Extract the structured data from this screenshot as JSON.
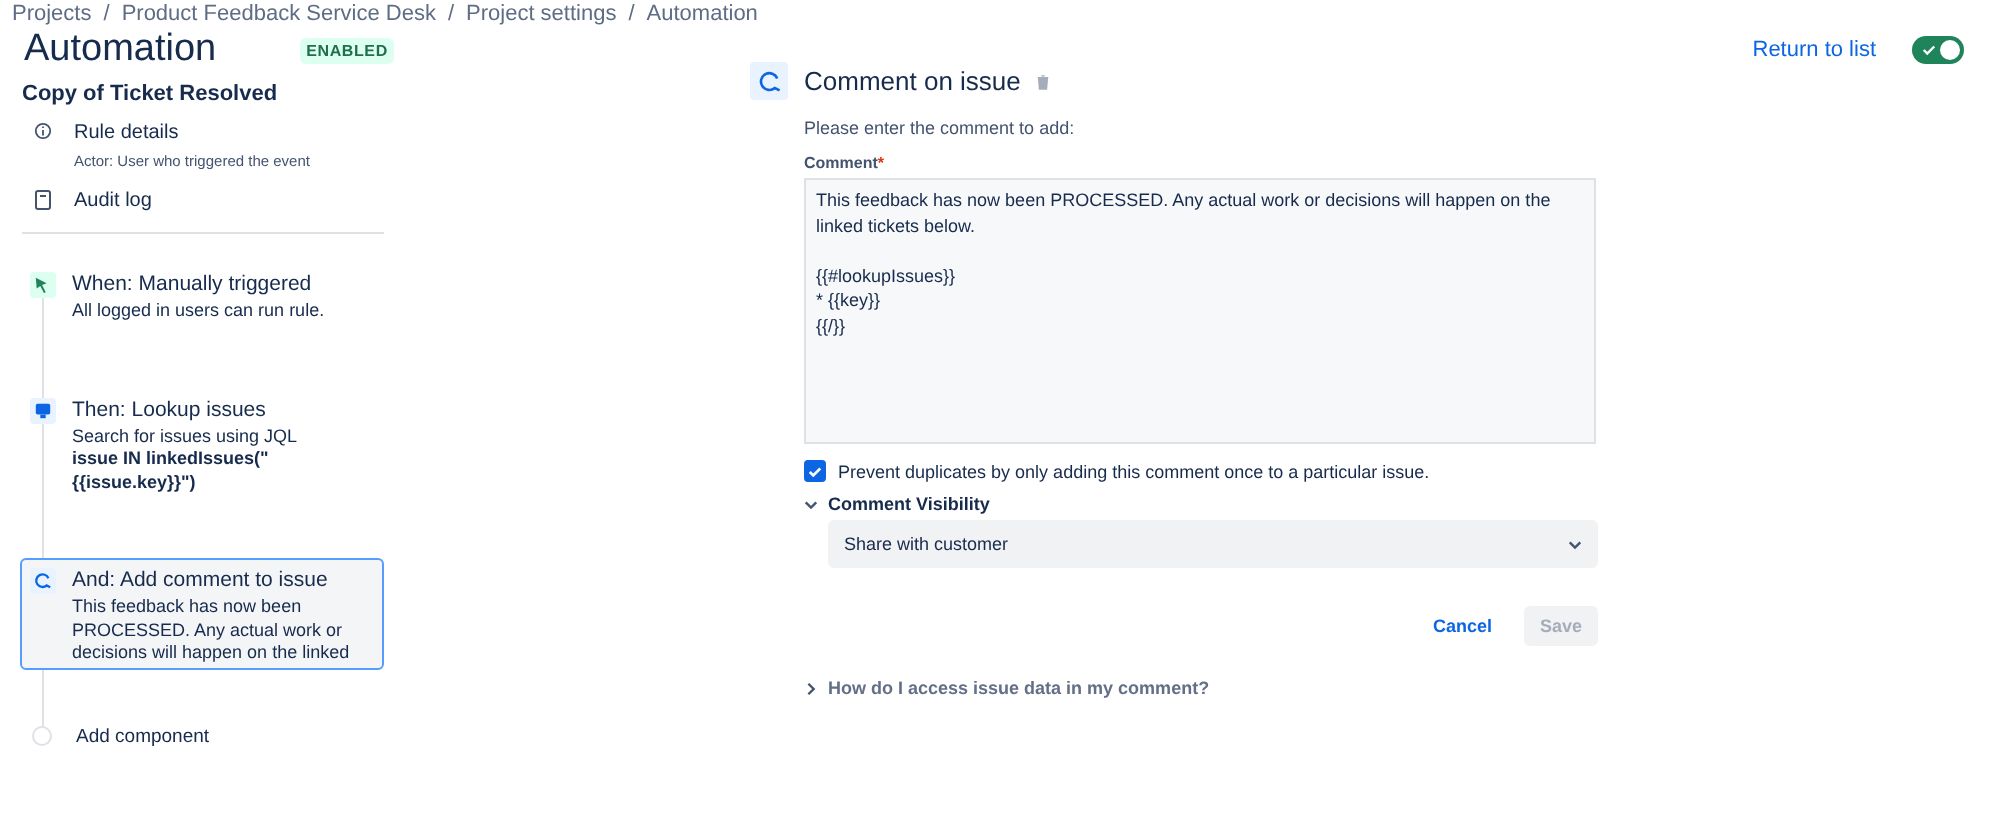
{
  "breadcrumbs": [
    "Projects",
    "Product Feedback Service Desk",
    "Project settings",
    "Automation"
  ],
  "breadcrumb_separators": [
    "/",
    "/",
    "/"
  ],
  "header": {
    "title": "Automation",
    "status": "ENABLED",
    "return_link": "Return to list",
    "toggle_on": true
  },
  "rule": {
    "name": "Copy of Ticket Resolved",
    "links": [
      {
        "kind": "info",
        "label": "Rule details",
        "sub": "Actor: User who triggered the event"
      },
      {
        "kind": "log",
        "label": "Audit log"
      }
    ],
    "steps": [
      {
        "kind": "trigger",
        "title": "When: Manually triggered",
        "lines": [
          "All logged in users can run rule."
        ],
        "selected": false
      },
      {
        "kind": "lookup",
        "title": "Then: Lookup issues",
        "lines": [
          "Search for issues using JQL",
          "**issue IN linkedIssues(\"**",
          "**{{issue.key}}\")**"
        ],
        "selected": false
      },
      {
        "kind": "comment",
        "title": "And: Add comment to issue",
        "lines": [
          "This feedback has now been",
          "PROCESSED. Any actual work or",
          "decisions will happen on the linked"
        ],
        "selected": true
      }
    ],
    "add_label": "Add component"
  },
  "panel": {
    "title": "Comment on issue",
    "prompt": "Please enter the comment to add:",
    "comment_label": "Comment",
    "required_mark": "*",
    "comment_value": "This feedback has now been PROCESSED. Any actual work or decisions will happen on the linked tickets below.\n\n{{#lookupIssues}}\n* {{key}}\n{{/}}",
    "prevent_duplicates": {
      "label": "Prevent duplicates by only adding this comment once to a particular issue.",
      "checked": true
    },
    "visibility": {
      "label": "Comment Visibility",
      "expanded": true,
      "value": "Share with customer"
    },
    "buttons": [
      {
        "kind": "link",
        "label": "Cancel",
        "disabled": false
      },
      {
        "kind": "primary",
        "label": "Save",
        "disabled": true
      }
    ],
    "help": {
      "label": "How do I access issue data in my comment?",
      "expanded": false
    }
  }
}
